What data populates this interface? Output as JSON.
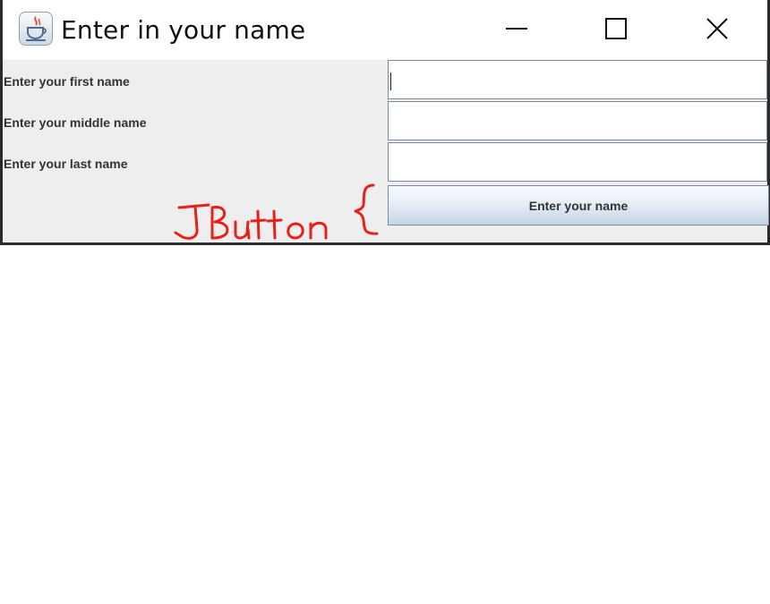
{
  "window": {
    "title": "Enter in your name",
    "app_icon": "java-coffee-cup-icon",
    "controls": {
      "minimize": "minimize-icon",
      "maximize": "maximize-icon",
      "close": "close-icon"
    }
  },
  "form": {
    "fields": [
      {
        "label": "Enter your first name",
        "value": ""
      },
      {
        "label": "Enter your middle name",
        "value": ""
      },
      {
        "label": "Enter your last name",
        "value": ""
      }
    ],
    "submit_label": "Enter your name"
  },
  "annotation": {
    "text": "JButton",
    "color": "#e8201a"
  }
}
